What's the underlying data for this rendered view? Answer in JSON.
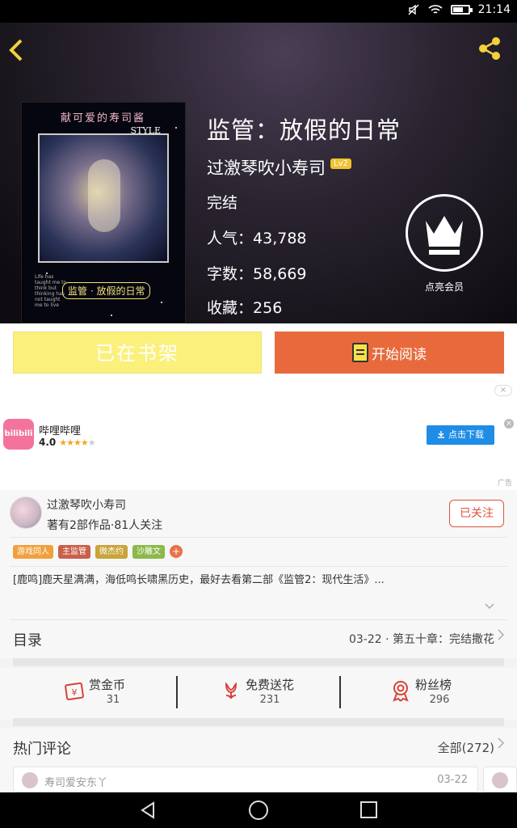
{
  "status_bar": {
    "time": "21:14",
    "battery_level": 0.7
  },
  "header": {
    "back_icon": "chevron-left-icon",
    "share_icon": "share-icon"
  },
  "cover": {
    "title_text": "献可爱的寿司酱",
    "style_text": "STYLE",
    "bottom_text": "监管 · 放假的日常",
    "small_text": "Life has taught me to think but thinking has not taught me to live"
  },
  "book": {
    "title": "监管：放假的日常",
    "author": "过激琴吹小寿司",
    "author_level": "Lv2",
    "status": "完结",
    "popularity_label": "人气：",
    "popularity": "43,788",
    "word_count_label": "字数：",
    "word_count": "58,669",
    "favorites_label": "收藏：",
    "favorites": "256",
    "vip_label": "点亮会员"
  },
  "actions": {
    "on_shelf_label": "已在书架",
    "start_reading_label": "开始阅读"
  },
  "ad": {
    "app_name": "哔哩哔哩",
    "icon_text": "bilibili",
    "rating": "4.0",
    "stars_filled": 4,
    "download_label": "点击下载",
    "ad_label": "广告",
    "close_symbol": "×"
  },
  "author_section": {
    "name": "过激琴吹小寿司",
    "stats": "著有2部作品·81人关注",
    "follow_label": "已关注",
    "tags": [
      {
        "label": "游戏同人",
        "color": "#f0a03c"
      },
      {
        "label": "主监管",
        "color": "#c9604a"
      },
      {
        "label": "微杰约",
        "color": "#c8a43a"
      },
      {
        "label": "沙雕文",
        "color": "#8db84a"
      }
    ],
    "tag_add": "+",
    "description": "[鹿鸣]鹿天星满满，海低鸣长啸黑历史，最好去看第二部《监管2：现代生活》..."
  },
  "toc": {
    "title": "目录",
    "latest": "03-22 · 第五十章：完结撒花"
  },
  "stats": [
    {
      "label": "赏金币",
      "value": "31",
      "icon": "coin-envelope-icon"
    },
    {
      "label": "免费送花",
      "value": "231",
      "icon": "flower-icon"
    },
    {
      "label": "粉丝榜",
      "value": "296",
      "icon": "medal-icon"
    }
  ],
  "comments": {
    "title": "热门评论",
    "all_label": "全部(272)",
    "first": {
      "user": "寿司爱安东丫",
      "date": "03-22"
    }
  },
  "colors": {
    "accent_orange": "#e86a3c",
    "shelf_yellow": "#fbf07c",
    "follow_red": "#e0533d"
  }
}
